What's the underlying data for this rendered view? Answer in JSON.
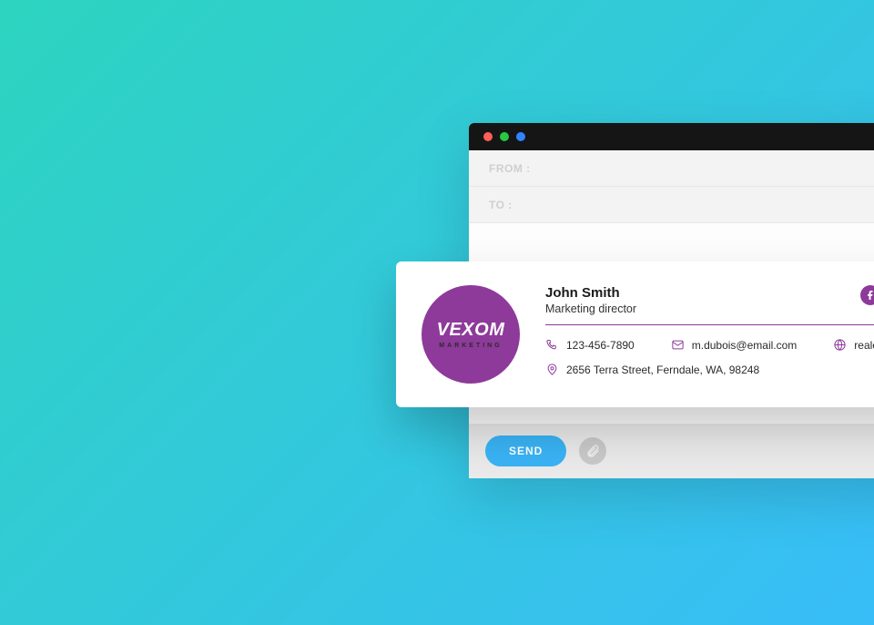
{
  "compose": {
    "from_label": "FROM :",
    "to_label": "TO :",
    "send_label": "SEND"
  },
  "signature": {
    "logo": {
      "name": "VEXOM",
      "tagline": "MARKETING"
    },
    "name": "John Smith",
    "title": "Marketing director",
    "phone": "123-456-7890",
    "email": "m.dubois@email.com",
    "website": "realestate&co",
    "address": "2656 Terra Street, Ferndale, WA, 98248"
  }
}
